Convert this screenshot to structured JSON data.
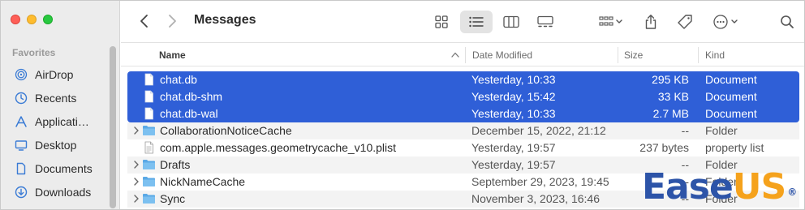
{
  "window": {
    "title": "Messages"
  },
  "sidebar": {
    "section_title": "Favorites",
    "items": [
      {
        "label": "AirDrop",
        "icon": "airdrop-icon"
      },
      {
        "label": "Recents",
        "icon": "clock-icon"
      },
      {
        "label": "Applicati…",
        "icon": "applications-icon"
      },
      {
        "label": "Desktop",
        "icon": "desktop-icon"
      },
      {
        "label": "Documents",
        "icon": "document-icon"
      },
      {
        "label": "Downloads",
        "icon": "download-icon"
      }
    ]
  },
  "columns": {
    "name": "Name",
    "date": "Date Modified",
    "size": "Size",
    "kind": "Kind"
  },
  "files": [
    {
      "name": "chat.db",
      "date": "Yesterday, 10:33",
      "size": "295 KB",
      "kind": "Document",
      "type": "file",
      "selected": true
    },
    {
      "name": "chat.db-shm",
      "date": "Yesterday, 15:42",
      "size": "33 KB",
      "kind": "Document",
      "type": "file",
      "selected": true
    },
    {
      "name": "chat.db-wal",
      "date": "Yesterday, 10:33",
      "size": "2.7 MB",
      "kind": "Document",
      "type": "file",
      "selected": true
    },
    {
      "name": "CollaborationNoticeCache",
      "date": "December 15, 2022, 21:12",
      "size": "--",
      "kind": "Folder",
      "type": "folder",
      "selected": false
    },
    {
      "name": "com.apple.messages.geometrycache_v10.plist",
      "date": "Yesterday, 19:57",
      "size": "237 bytes",
      "kind": "property list",
      "type": "plist",
      "selected": false
    },
    {
      "name": "Drafts",
      "date": "Yesterday, 19:57",
      "size": "--",
      "kind": "Folder",
      "type": "folder",
      "selected": false
    },
    {
      "name": "NickNameCache",
      "date": "September 29, 2023, 19:45",
      "size": "--",
      "kind": "Folder",
      "type": "folder",
      "selected": false
    },
    {
      "name": "Sync",
      "date": "November 3, 2023, 16:46",
      "size": "--",
      "kind": "Folder",
      "type": "folder",
      "selected": false
    }
  ],
  "watermark": {
    "part1": "Ease",
    "part2": "US",
    "mark": "®"
  },
  "colors": {
    "selection": "#2f5fd7",
    "folder": "#5aa9e6",
    "accent": "#2d54a8",
    "accent2": "#f5a21c"
  }
}
